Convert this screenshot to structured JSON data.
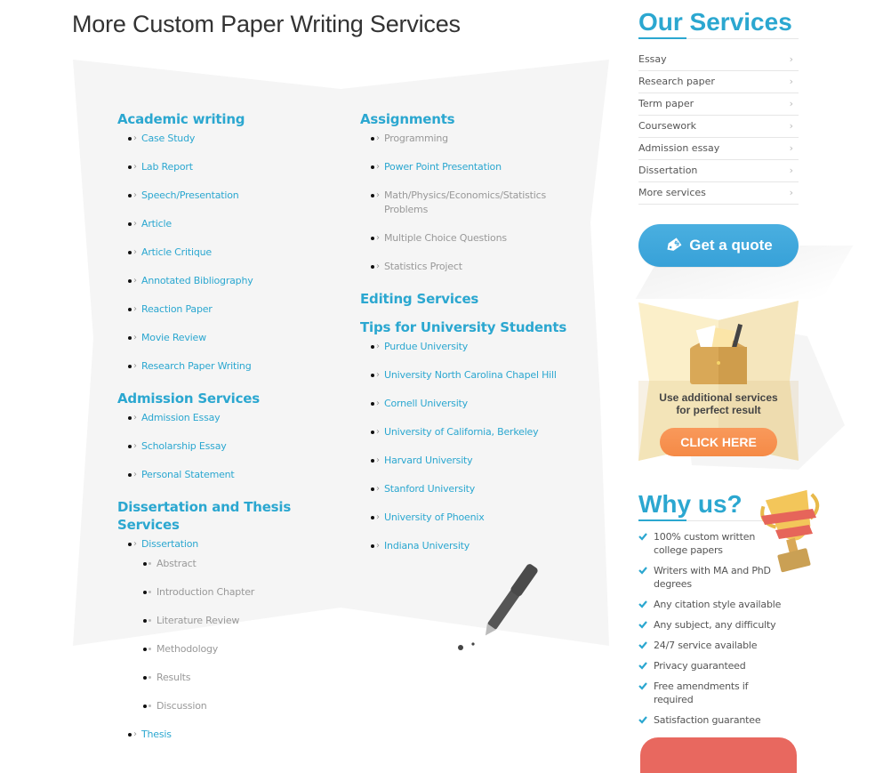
{
  "page_title": "More Custom Paper Writing Services",
  "colors": {
    "accent": "#2ba7d0",
    "paper_bg": "#f5f5f5",
    "quote_button": "#3ea6dc",
    "click_button": "#f68d4a",
    "bottom_button": "#e8685f"
  },
  "left_column": [
    {
      "title": "Academic writing",
      "items": [
        {
          "label": "Case Study",
          "link": true
        },
        {
          "label": "Lab Report",
          "link": true
        },
        {
          "label": "Speech/Presentation",
          "link": true
        },
        {
          "label": "Article",
          "link": true
        },
        {
          "label": "Article Critique",
          "link": true
        },
        {
          "label": "Annotated Bibliography",
          "link": true
        },
        {
          "label": "Reaction Paper",
          "link": true
        },
        {
          "label": "Movie Review",
          "link": true
        },
        {
          "label": "Research Paper Writing",
          "link": true
        }
      ]
    },
    {
      "title": "Admission Services",
      "items": [
        {
          "label": "Admission Essay",
          "link": true
        },
        {
          "label": "Scholarship Essay",
          "link": true
        },
        {
          "label": "Personal Statement",
          "link": true
        }
      ]
    },
    {
      "title": "Dissertation and Thesis Services",
      "items": [
        {
          "label": "Dissertation",
          "link": true,
          "children": [
            "Abstract",
            "Introduction Chapter",
            "Literature Review",
            "Methodology",
            "Results",
            "Discussion"
          ]
        },
        {
          "label": "Thesis",
          "link": true
        }
      ]
    }
  ],
  "right_column": [
    {
      "title": "Assignments",
      "items": [
        {
          "label": "Programming",
          "link": false
        },
        {
          "label": "Power Point Presentation",
          "link": true
        },
        {
          "label": "Math/Physics/Economics/Statistics Problems",
          "link": false,
          "line1": "Math/Physics/Economics/Statistics",
          "line2": "Problems"
        },
        {
          "label": "Multiple Choice Questions",
          "link": false
        },
        {
          "label": "Statistics Project",
          "link": false
        }
      ]
    },
    {
      "title": "Editing Services",
      "items": []
    },
    {
      "title": "Tips for University Students",
      "items": [
        {
          "label": "Purdue University",
          "link": true
        },
        {
          "label": "University North Carolina Chapel Hill",
          "link": true
        },
        {
          "label": "Cornell University",
          "link": true
        },
        {
          "label": "University of California, Berkeley",
          "link": true
        },
        {
          "label": "Harvard University",
          "link": true
        },
        {
          "label": "Stanford University",
          "link": true
        },
        {
          "label": "University of Phoenix",
          "link": true
        },
        {
          "label": "Indiana University",
          "link": true
        }
      ]
    }
  ],
  "sidebar": {
    "services_heading": "Our Services",
    "services": [
      "Essay",
      "Research paper",
      "Term paper",
      "Coursework",
      "Admission essay",
      "Dissertation",
      "More services"
    ],
    "arrow_glyph": "›",
    "quote_button": "Get a quote",
    "promo_text_line1": "Use additional services",
    "promo_text_line2": "for perfect result",
    "promo_button": "CLICK HERE",
    "why_heading": "Why us?",
    "why_items": [
      "100% custom written college papers",
      "Writers with MA and PhD degrees",
      "Any citation style available",
      "Any subject, any difficulty",
      "24/7 service available",
      "Privacy guaranteed",
      "Free amendments if required",
      "Satisfaction guarantee"
    ]
  },
  "icons": {
    "list_chevron": "›",
    "sub_dot": "•"
  }
}
